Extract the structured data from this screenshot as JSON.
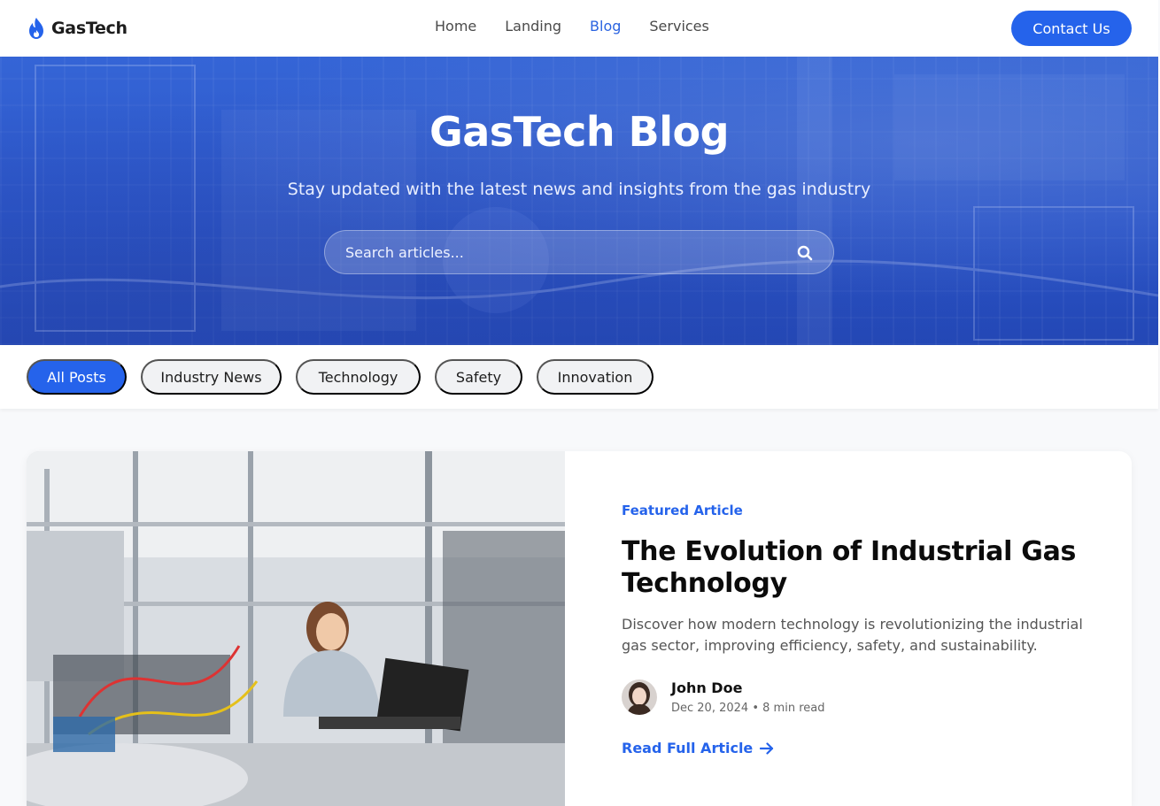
{
  "header": {
    "brand": "GasTech",
    "nav": [
      {
        "label": "Home"
      },
      {
        "label": "Landing"
      },
      {
        "label": "Blog"
      },
      {
        "label": "Services"
      }
    ],
    "active_nav": "Blog",
    "contact_label": "Contact Us"
  },
  "hero": {
    "title": "GasTech Blog",
    "subtitle": "Stay updated with the latest news and insights from the gas industry",
    "search_placeholder": "Search articles..."
  },
  "filters": {
    "items": [
      "All Posts",
      "Industry News",
      "Technology",
      "Safety",
      "Innovation"
    ],
    "active": "All Posts"
  },
  "featured": {
    "label": "Featured Article",
    "title": "The Evolution of Industrial Gas Technology",
    "description": "Discover how modern technology is revolutionizing the industrial gas sector, improving efficiency, safety, and sustainability.",
    "author": "John Doe",
    "date": "Dec 20, 2024",
    "read_time": "8 min read",
    "read_link": "Read Full Article"
  },
  "colors": {
    "accent": "#2563eb",
    "hero_bg": "#2b55c9"
  },
  "icons": {
    "logo": "flame-icon",
    "search": "search-icon",
    "arrow": "arrow-right-icon"
  }
}
